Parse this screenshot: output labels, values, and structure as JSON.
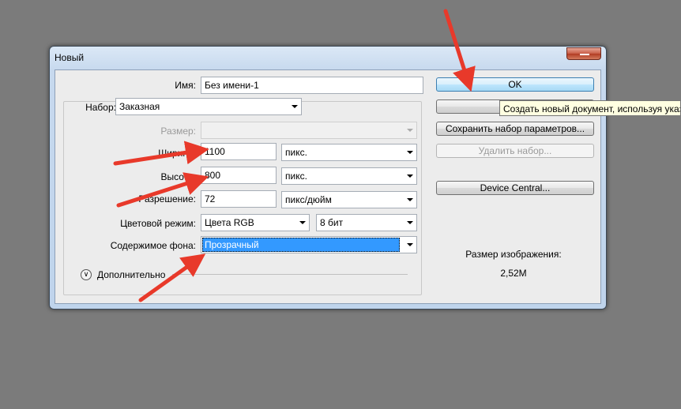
{
  "window": {
    "title": "Новый"
  },
  "form": {
    "name_label": "Имя:",
    "name_value": "Без имени-1",
    "preset_label": "Набор:",
    "preset_value": "Заказная",
    "size_label": "Размер:",
    "size_value": "",
    "width_label": "Ширина:",
    "width_value": "1100",
    "width_unit": "пикс.",
    "height_label": "Высота:",
    "height_value": "800",
    "height_unit": "пикс.",
    "resolution_label": "Разрешение:",
    "resolution_value": "72",
    "resolution_unit": "пикс/дюйм",
    "color_mode_label": "Цветовой режим:",
    "color_mode_value": "Цвета RGB",
    "bit_depth_value": "8 бит",
    "background_label": "Содержимое фона:",
    "background_value": "Прозрачный",
    "advanced_label": "Дополнительно"
  },
  "buttons": {
    "ok": "OK",
    "cancel": "",
    "save_preset": "Сохранить набор параметров...",
    "delete_preset": "Удалить набор...",
    "device_central": "Device Central..."
  },
  "tooltip": {
    "text": "Создать новый документ, используя указ"
  },
  "image_size": {
    "label": "Размер изображения:",
    "value": "2,52M"
  },
  "colors": {
    "desktop": "#7b7b7b",
    "annotation_arrow": "#e8392a",
    "selection": "#3399ff"
  }
}
